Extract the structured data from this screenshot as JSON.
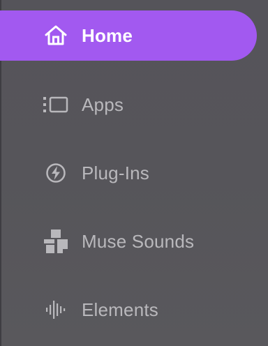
{
  "colors": {
    "accent": "#a259f0",
    "background": "#56555a",
    "inactive_text": "#b9b8bc",
    "active_text": "#ffffff"
  },
  "nav": {
    "items": [
      {
        "label": "Home",
        "icon": "house-icon",
        "active": true
      },
      {
        "label": "Apps",
        "icon": "apps-list-icon",
        "active": false
      },
      {
        "label": "Plug-Ins",
        "icon": "lightning-bolt-icon",
        "active": false
      },
      {
        "label": "Muse Sounds",
        "icon": "muse-sounds-icon",
        "active": false
      },
      {
        "label": "Elements",
        "icon": "waveform-icon",
        "active": false
      }
    ]
  }
}
